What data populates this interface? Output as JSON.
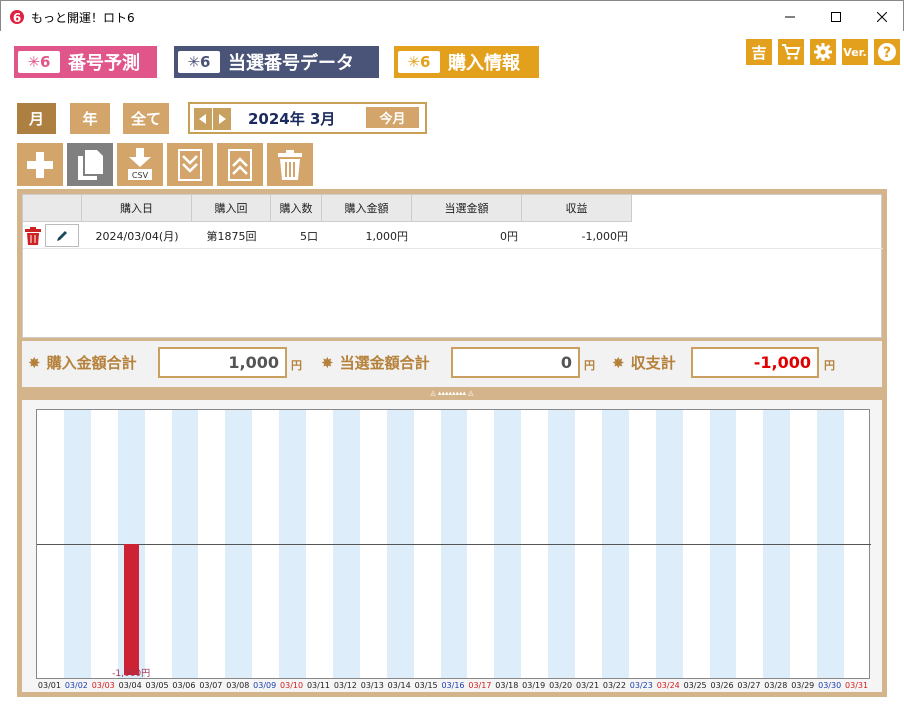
{
  "window": {
    "title": "もっと開運！ロト6",
    "icon_text": "6"
  },
  "tabs": [
    {
      "label": "番号予測",
      "logo": "✳6",
      "color": "#e0568a"
    },
    {
      "label": "当選番号データ",
      "logo": "✳6",
      "color": "#4a5478"
    },
    {
      "label": "購入情報",
      "logo": "✳6",
      "color": "#e3a01c"
    }
  ],
  "toolbar_icons": [
    "吉",
    "cart-icon",
    "gear-icon",
    "Ver.",
    "help-icon"
  ],
  "period": {
    "month": "月",
    "year": "年",
    "all": "全て"
  },
  "month_nav": {
    "label": "2024年 3月",
    "this_month": "今月"
  },
  "table": {
    "headers": [
      "購入日",
      "購入回",
      "購入数",
      "購入金額",
      "当選金額",
      "収益"
    ],
    "rows": [
      {
        "date": "2024/03/04(月)",
        "draw": "第1875回",
        "count": "5口",
        "cost": "1,000円",
        "win": "0円",
        "profit": "-1,000円"
      }
    ]
  },
  "totals": {
    "purchase_label": "購入金額合計",
    "purchase_value": "1,000",
    "win_label": "当選金額合計",
    "win_value": "0",
    "balance_label": "収支計",
    "balance_value": "-1,000",
    "yen": "円"
  },
  "splitter_glyph": "◬ ▴▴▴▴▴▴▴▴ ◬",
  "chart_data": {
    "type": "bar",
    "categories": [
      "03/01",
      "03/02",
      "03/03",
      "03/04",
      "03/05",
      "03/06",
      "03/07",
      "03/08",
      "03/09",
      "03/10",
      "03/11",
      "03/12",
      "03/13",
      "03/14",
      "03/15",
      "03/16",
      "03/17",
      "03/18",
      "03/19",
      "03/20",
      "03/21",
      "03/22",
      "03/23",
      "03/24",
      "03/25",
      "03/26",
      "03/27",
      "03/28",
      "03/29",
      "03/30",
      "03/31"
    ],
    "category_colors": [
      "#222",
      "#1a3fb0",
      "#d02020",
      "#222",
      "#222",
      "#222",
      "#222",
      "#222",
      "#1a3fb0",
      "#d02020",
      "#222",
      "#222",
      "#222",
      "#222",
      "#222",
      "#1a3fb0",
      "#d02020",
      "#222",
      "#222",
      "#222",
      "#222",
      "#222",
      "#1a3fb0",
      "#d02020",
      "#222",
      "#222",
      "#222",
      "#222",
      "#222",
      "#1a3fb0",
      "#d02020"
    ],
    "values": [
      0,
      0,
      0,
      -1000,
      0,
      0,
      0,
      0,
      0,
      0,
      0,
      0,
      0,
      0,
      0,
      0,
      0,
      0,
      0,
      0,
      0,
      0,
      0,
      0,
      0,
      0,
      0,
      0,
      0,
      0,
      0
    ],
    "data_labels": {
      "3": "-1,000円"
    },
    "ylim": [
      -1000,
      1000
    ],
    "bar_color": "#cc2233",
    "stripe_color": "#ddeefa",
    "title": "",
    "xlabel": "",
    "ylabel": ""
  }
}
